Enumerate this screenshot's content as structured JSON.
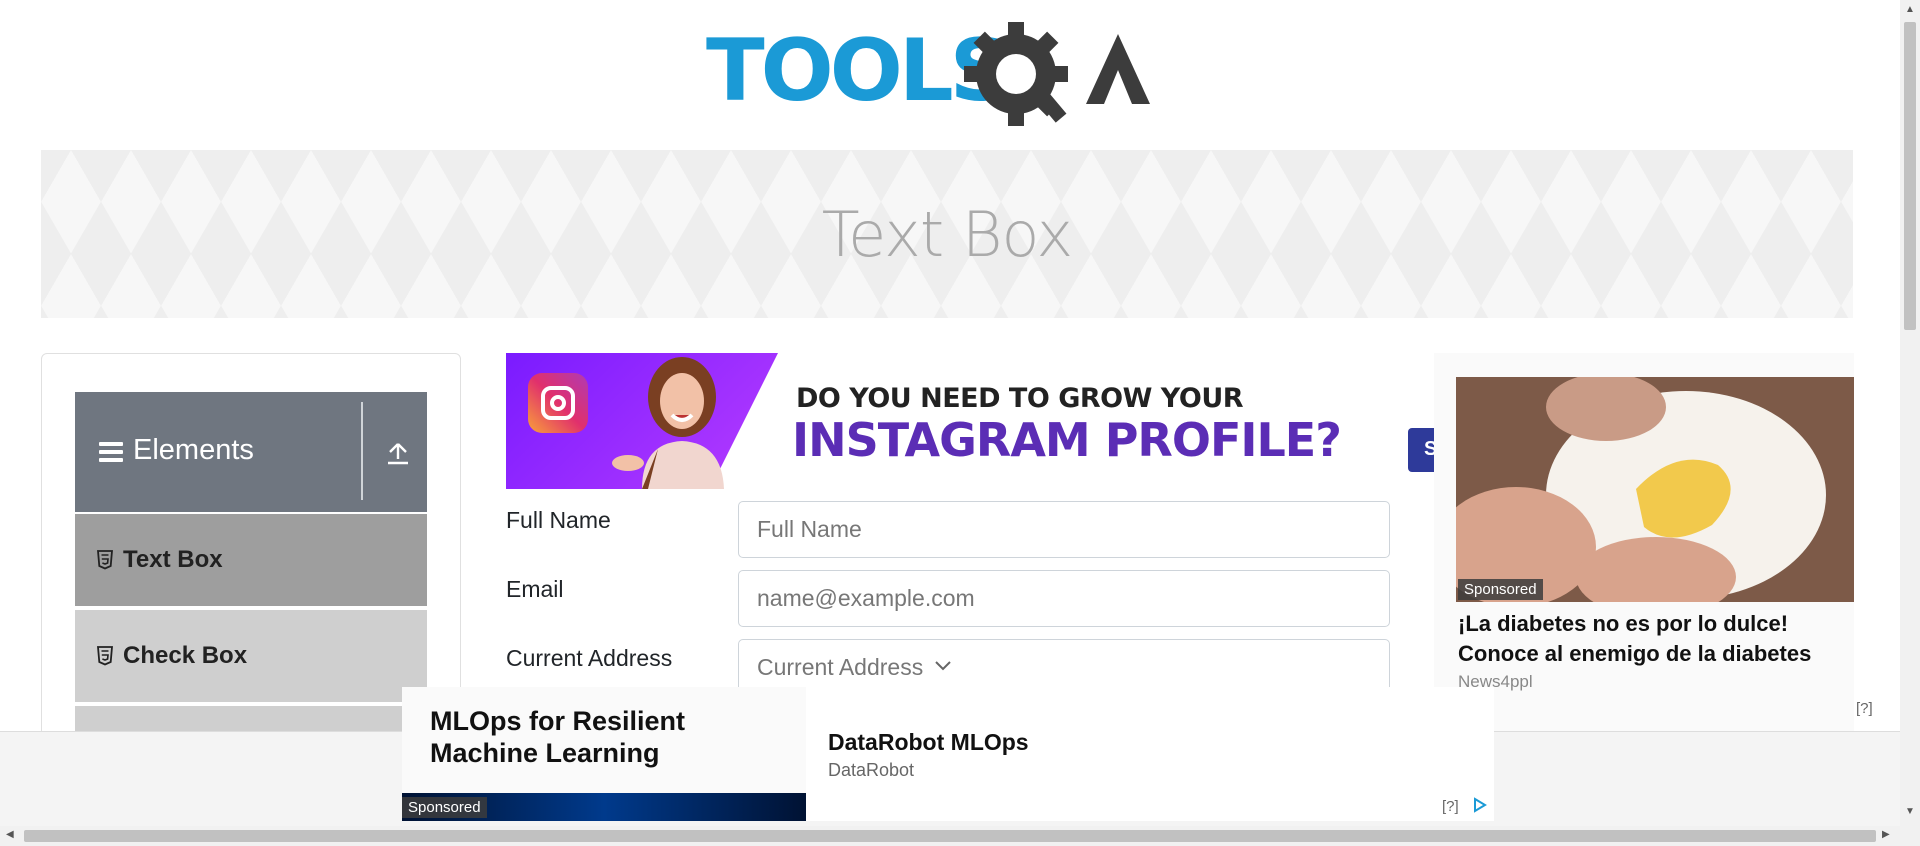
{
  "header": {
    "logo_text": "TOOLSQA"
  },
  "banner": {
    "title": "Text Box"
  },
  "sidebar": {
    "group_title": "Elements",
    "items": [
      {
        "label": "Text Box",
        "active": true
      },
      {
        "label": "Check Box",
        "active": false
      }
    ]
  },
  "ads": {
    "instagram": {
      "line1": "DO YOU NEED TO GROW YOUR",
      "line2": "INSTAGRAM PROFILE?"
    },
    "peek_button_text": "S",
    "right": {
      "sponsored": "Sponsored",
      "headline": "¡La diabetes no es por lo dulce! Conoce al enemigo de la diabetes",
      "source": "News4ppl",
      "help": "[?]"
    },
    "bottom": {
      "image_title": "MLOps for Resilient Machine Learning",
      "sponsored": "Sponsored",
      "headline": "DataRobot MLOps",
      "source": "DataRobot",
      "help": "[?]"
    }
  },
  "form": {
    "full_name": {
      "label": "Full Name",
      "placeholder": "Full Name",
      "value": ""
    },
    "email": {
      "label": "Email",
      "placeholder": "name@example.com",
      "value": ""
    },
    "current_address": {
      "label": "Current Address",
      "placeholder": "Current Address",
      "value": ""
    }
  },
  "colors": {
    "brand_blue": "#1b9ad6",
    "brand_dark": "#3c3c3c",
    "group_header": "#6f7680",
    "active_item": "#9e9e9e",
    "inactive_item": "#cfcfcf",
    "instagram_purple": "#5b2db5"
  },
  "icons": {
    "menu": "hamburger-icon",
    "toggle": "upload-arrow-icon",
    "item": "html5-icon",
    "dropdown": "chevron-down-icon"
  }
}
